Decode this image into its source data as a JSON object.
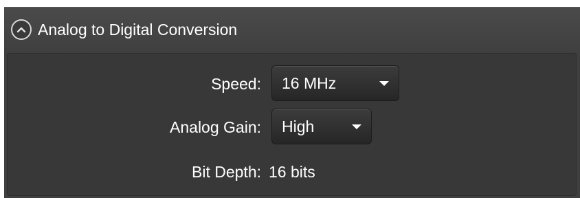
{
  "panel": {
    "title": "Analog to Digital Conversion",
    "collapse_icon": "chevron-up-circle-icon"
  },
  "settings": {
    "speed": {
      "label": "Speed:",
      "value": "16 MHz"
    },
    "analog_gain": {
      "label": "Analog Gain:",
      "value": "High"
    },
    "bit_depth": {
      "label": "Bit Depth:",
      "value": "16 bits"
    }
  },
  "colors": {
    "panel_background": "#3f3f3f",
    "body_background": "#383838",
    "text": "#ffffff"
  }
}
